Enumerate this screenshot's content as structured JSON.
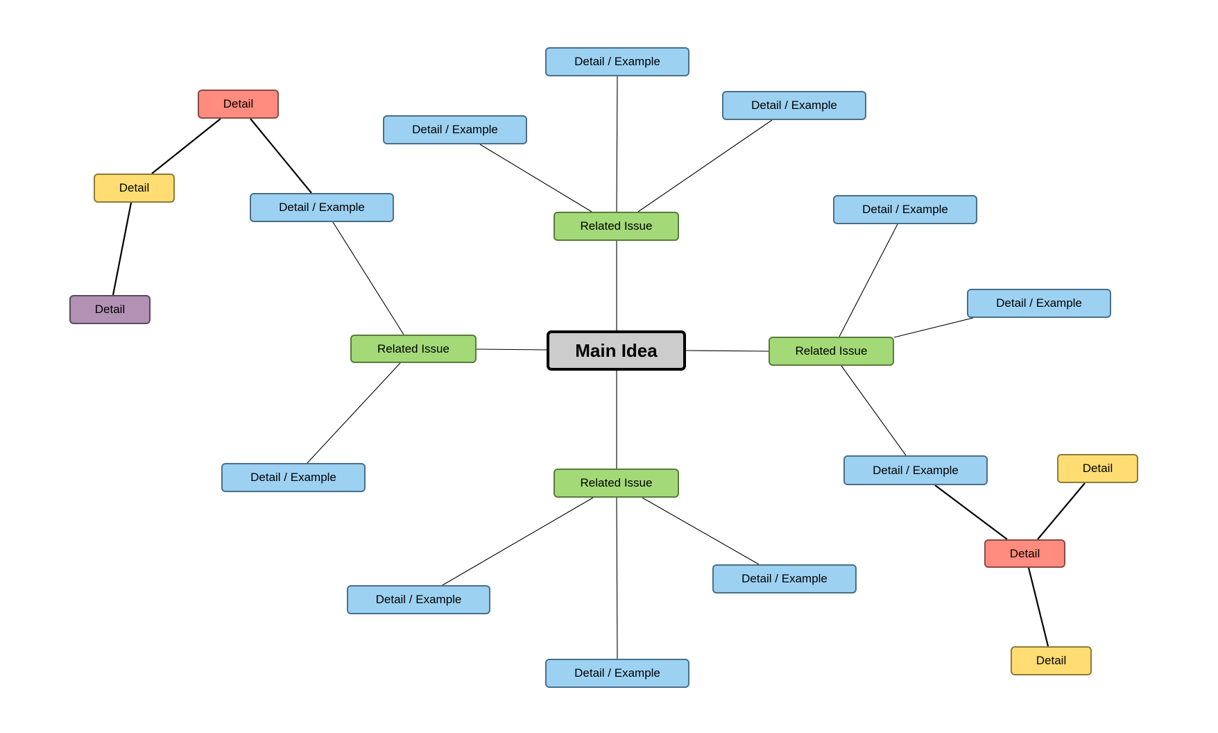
{
  "diagram": {
    "title": "Main Idea",
    "styles": {
      "main": {
        "fill": "#cccccc",
        "stroke": "#000000"
      },
      "related": {
        "fill": "#a3d977",
        "stroke": "#5a7a3a"
      },
      "detail_example": {
        "fill": "#9dd1f2",
        "stroke": "#4a6f8a"
      },
      "detail_red": {
        "fill": "#ff8c7e",
        "stroke": "#8a4a44"
      },
      "detail_yellow": {
        "fill": "#ffdd73",
        "stroke": "#8a7a3a"
      },
      "detail_purple": {
        "fill": "#b291b4",
        "stroke": "#5a4a5c"
      }
    },
    "nodes": [
      {
        "id": "main",
        "label": "Main Idea",
        "style": "main"
      },
      {
        "id": "ri_top",
        "label": "Related Issue",
        "style": "related"
      },
      {
        "id": "ri_left",
        "label": "Related Issue",
        "style": "related"
      },
      {
        "id": "ri_right",
        "label": "Related Issue",
        "style": "related"
      },
      {
        "id": "ri_bottom",
        "label": "Related Issue",
        "style": "related"
      },
      {
        "id": "de_top_center",
        "label": "Detail / Example",
        "style": "detail_example"
      },
      {
        "id": "de_top_left",
        "label": "Detail / Example",
        "style": "detail_example"
      },
      {
        "id": "de_top_right",
        "label": "Detail / Example",
        "style": "detail_example"
      },
      {
        "id": "de_left_upper",
        "label": "Detail / Example",
        "style": "detail_example"
      },
      {
        "id": "de_left_lower",
        "label": "Detail / Example",
        "style": "detail_example"
      },
      {
        "id": "de_right_top",
        "label": "Detail / Example",
        "style": "detail_example"
      },
      {
        "id": "de_right_mid",
        "label": "Detail / Example",
        "style": "detail_example"
      },
      {
        "id": "de_right_low",
        "label": "Detail / Example",
        "style": "detail_example"
      },
      {
        "id": "de_bottom_left",
        "label": "Detail / Example",
        "style": "detail_example"
      },
      {
        "id": "de_bottom_right",
        "label": "Detail / Example",
        "style": "detail_example"
      },
      {
        "id": "de_bottom",
        "label": "Detail / Example",
        "style": "detail_example"
      },
      {
        "id": "d_red_left",
        "label": "Detail",
        "style": "detail_red"
      },
      {
        "id": "d_yellow_left",
        "label": "Detail",
        "style": "detail_yellow"
      },
      {
        "id": "d_purple",
        "label": "Detail",
        "style": "detail_purple"
      },
      {
        "id": "d_red_right",
        "label": "Detail",
        "style": "detail_red"
      },
      {
        "id": "d_yellow_right_top",
        "label": "Detail",
        "style": "detail_yellow"
      },
      {
        "id": "d_yellow_bottom",
        "label": "Detail",
        "style": "detail_yellow"
      }
    ],
    "edges": [
      {
        "from": "main",
        "to": "ri_top"
      },
      {
        "from": "main",
        "to": "ri_left"
      },
      {
        "from": "main",
        "to": "ri_right"
      },
      {
        "from": "main",
        "to": "ri_bottom"
      },
      {
        "from": "ri_top",
        "to": "de_top_center"
      },
      {
        "from": "ri_top",
        "to": "de_top_left"
      },
      {
        "from": "ri_top",
        "to": "de_top_right"
      },
      {
        "from": "ri_left",
        "to": "de_left_upper"
      },
      {
        "from": "ri_left",
        "to": "de_left_lower"
      },
      {
        "from": "ri_right",
        "to": "de_right_top"
      },
      {
        "from": "ri_right",
        "to": "de_right_mid"
      },
      {
        "from": "ri_right",
        "to": "de_right_low"
      },
      {
        "from": "ri_bottom",
        "to": "de_bottom_left"
      },
      {
        "from": "ri_bottom",
        "to": "de_bottom_right"
      },
      {
        "from": "ri_bottom",
        "to": "de_bottom"
      },
      {
        "from": "de_left_upper",
        "to": "d_red_left",
        "bold": true
      },
      {
        "from": "d_red_left",
        "to": "d_yellow_left",
        "bold": true
      },
      {
        "from": "d_yellow_left",
        "to": "d_purple",
        "bold": true
      },
      {
        "from": "de_right_low",
        "to": "d_red_right",
        "bold": true
      },
      {
        "from": "d_red_right",
        "to": "d_yellow_right_top",
        "bold": true
      },
      {
        "from": "d_red_right",
        "to": "d_yellow_bottom",
        "bold": true
      }
    ]
  }
}
